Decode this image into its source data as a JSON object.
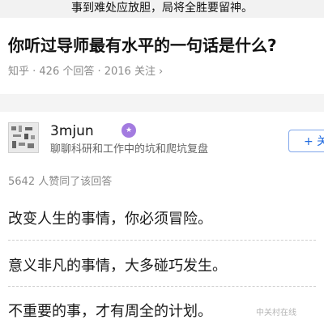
{
  "caption": "事到难处应放胆，局将全胜要留神。",
  "question": {
    "title": "你听过导师最有水平的一句话是什么?",
    "meta": "知乎 · 426 个回答 · 2016 关注",
    "chevron": "›"
  },
  "author": {
    "name": "3mjun",
    "badge": "★",
    "bio": "聊聊科研和工作中的坑和爬坑复盘",
    "follow_label": "+ 关"
  },
  "answer": {
    "likes": "5642 人赞同了该回答",
    "lines": [
      "改变人生的事情，你必须冒险。",
      "意义非凡的事情，大多碰巧发生。",
      "不重要的事，才有周全的计划。"
    ]
  },
  "watermark": "中关村在线",
  "colors": {
    "accent": "#1f6ae0",
    "badge": "#a37be0"
  }
}
